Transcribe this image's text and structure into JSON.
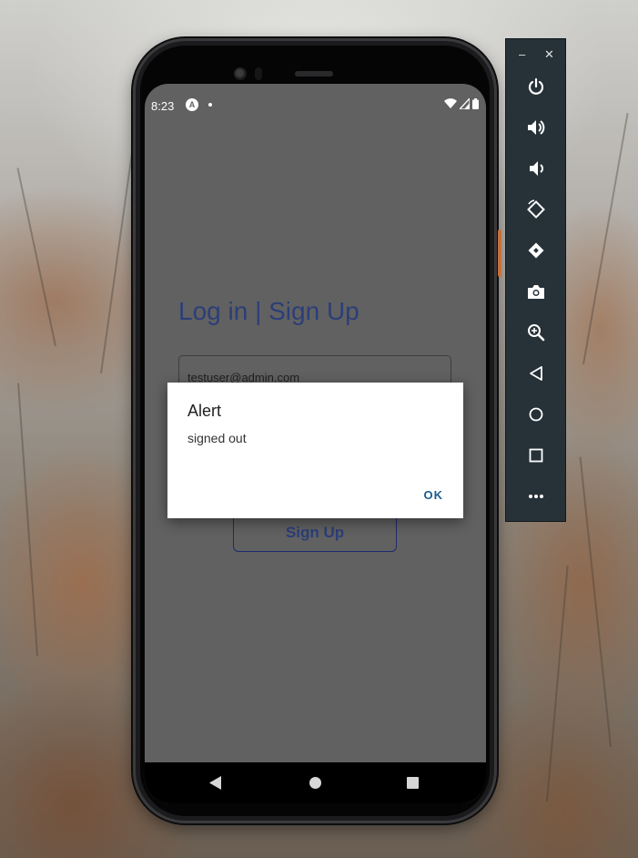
{
  "status_bar": {
    "time": "8:23",
    "app_icon_glyph": "A"
  },
  "app": {
    "title": "Log in | Sign Up",
    "email_value": "testuser@admin.com",
    "signup_label": "Sign Up"
  },
  "alert": {
    "title": "Alert",
    "message": "signed out",
    "ok_label": "OK"
  },
  "emulator_toolbar": {
    "minimize_label": "–",
    "close_label": "✕",
    "buttons": [
      "power-icon",
      "volume-up-icon",
      "volume-down-icon",
      "rotate-left-icon",
      "rotate-right-icon",
      "camera-icon",
      "zoom-icon",
      "back-icon",
      "home-icon",
      "overview-icon",
      "more-icon"
    ]
  },
  "colors": {
    "screen_dim": "#616161",
    "title_accent": "#2c3e78",
    "dialog_button": "#1d5c91",
    "toolbar_bg": "#263238"
  }
}
